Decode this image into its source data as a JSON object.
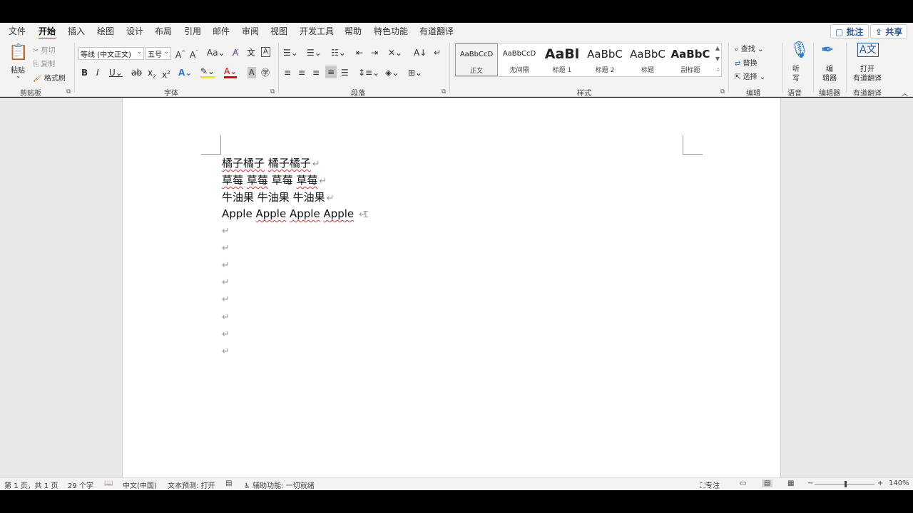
{
  "menu": {
    "tabs": [
      "文件",
      "开始",
      "插入",
      "绘图",
      "设计",
      "布局",
      "引用",
      "邮件",
      "审阅",
      "视图",
      "开发工具",
      "帮助",
      "特色功能",
      "有道翻译"
    ],
    "active_tab": "开始",
    "comment_button": "批注",
    "share_button": "共享"
  },
  "ribbon": {
    "clipboard": {
      "paste": "粘贴",
      "cut": "剪切",
      "copy": "复制",
      "format_painter": "格式刷",
      "label": "剪贴板"
    },
    "font": {
      "font_name": "等线 (中文正文)",
      "font_size": "五号",
      "label": "字体"
    },
    "paragraph": {
      "label": "段落"
    },
    "styles": {
      "label": "样式",
      "items": [
        {
          "preview": "AaBbCcD",
          "name": "正文"
        },
        {
          "preview": "AaBbCcD",
          "name": "无间隔"
        },
        {
          "preview": "AaBl",
          "name": "标题 1"
        },
        {
          "preview": "AaBbC",
          "name": "标题 2"
        },
        {
          "preview": "AaBbC",
          "name": "标题"
        },
        {
          "preview": "AaBbC",
          "name": "副标题"
        }
      ]
    },
    "editing": {
      "find": "查找",
      "replace": "替换",
      "select": "选择",
      "label": "编辑"
    },
    "voice": {
      "dictate_line1": "听",
      "dictate_line2": "写",
      "label": "语音"
    },
    "editor": {
      "line1": "编",
      "line2": "辑器",
      "label": "编辑器"
    },
    "youdao": {
      "line1": "打开",
      "line2": "有道翻译",
      "label": "有道翻译"
    }
  },
  "document": {
    "lines": [
      {
        "segments": [
          "橘子橘子",
          "橘子橘子"
        ]
      },
      {
        "segments": [
          "草莓",
          "草莓",
          "草莓",
          "草莓"
        ]
      },
      {
        "segments": [
          "牛油果",
          "牛油果",
          "牛油果"
        ]
      },
      {
        "segments": [
          "Apple",
          "Apple",
          "Apple",
          "Apple"
        ]
      }
    ],
    "paragraph_mark": "↵",
    "empty_paragraphs": 8
  },
  "statusbar": {
    "page": "第 1 页，共 1 页",
    "word_count": "29 个字",
    "language": "中文(中国)",
    "text_prediction": "文本预测: 打开",
    "accessibility": "辅助功能: 一切就绪",
    "focus": "专注",
    "zoom": "140%"
  },
  "colors": {
    "accent": "#2b579a",
    "ribbon_bg": "#f3f3f3",
    "canvas_bg": "#e8e8e8"
  }
}
